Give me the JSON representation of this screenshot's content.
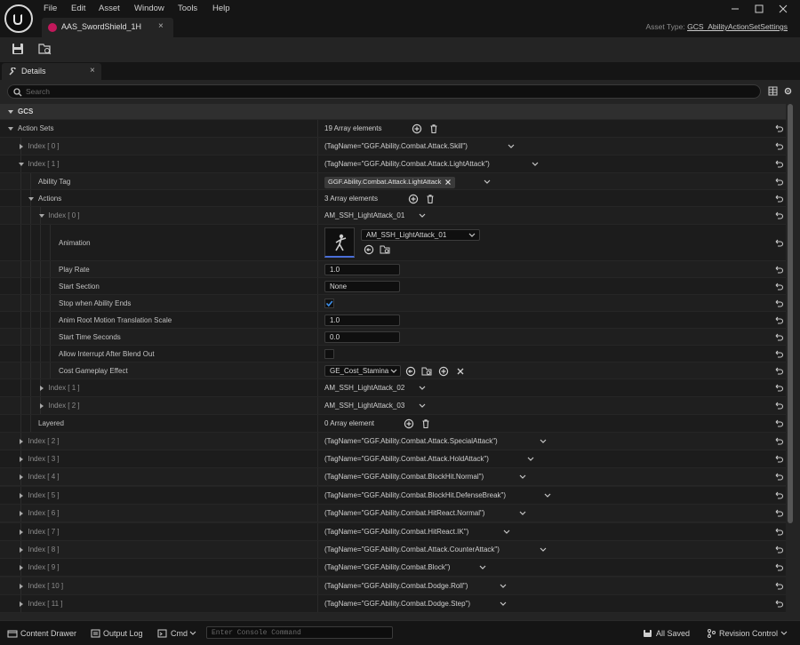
{
  "window": {
    "menu": [
      "File",
      "Edit",
      "Asset",
      "Window",
      "Tools",
      "Help"
    ],
    "tab_title": "AAS_SwordShield_1H",
    "asset_type_label": "Asset Type:",
    "asset_type_value": "GCS_AbilityActionSetSettings"
  },
  "details": {
    "tab_label": "Details",
    "search_placeholder": "Search"
  },
  "category": "GCS",
  "rows": [
    {
      "name": "Action Sets",
      "value": "19 Array elements"
    },
    {
      "name": "Index [ 0 ]",
      "value": "(TagName=\"GGF.Ability.Combat.Attack.Skill\")"
    },
    {
      "name": "Index [ 1 ]",
      "value": "(TagName=\"GGF.Ability.Combat.Attack.LightAttack\")"
    },
    {
      "name": "Ability Tag",
      "value": "GGF.Ability.Combat.Attack.LightAttack"
    },
    {
      "name": "Actions",
      "value": "3 Array elements"
    },
    {
      "name": "Index [ 0 ]",
      "value": "AM_SSH_LightAttack_01"
    },
    {
      "name": "Animation",
      "value": "AM_SSH_LightAttack_01"
    },
    {
      "name": "Play Rate",
      "value": "1.0"
    },
    {
      "name": "Start Section",
      "value": "None"
    },
    {
      "name": "Stop when Ability Ends",
      "value": true
    },
    {
      "name": "Anim Root Motion Translation Scale",
      "value": "1.0"
    },
    {
      "name": "Start Time Seconds",
      "value": "0.0"
    },
    {
      "name": "Allow Interrupt After Blend Out",
      "value": false
    },
    {
      "name": "Cost Gameplay Effect",
      "value": "GE_Cost_Stamina"
    },
    {
      "name": "Index [ 1 ]",
      "value": "AM_SSH_LightAttack_02"
    },
    {
      "name": "Index [ 2 ]",
      "value": "AM_SSH_LightAttack_03"
    },
    {
      "name": "Layered",
      "value": "0 Array element"
    },
    {
      "name": "Index [ 2 ]",
      "value": "(TagName=\"GGF.Ability.Combat.Attack.SpecialAttack\")"
    },
    {
      "name": "Index [ 3 ]",
      "value": "(TagName=\"GGF.Ability.Combat.Attack.HoldAttack\")"
    },
    {
      "name": "Index [ 4 ]",
      "value": "(TagName=\"GGF.Ability.Combat.BlockHit.Normal\")"
    },
    {
      "name": "Index [ 5 ]",
      "value": "(TagName=\"GGF.Ability.Combat.BlockHit.DefenseBreak\")"
    },
    {
      "name": "Index [ 6 ]",
      "value": "(TagName=\"GGF.Ability.Combat.HitReact.Normal\")"
    },
    {
      "name": "Index [ 7 ]",
      "value": "(TagName=\"GGF.Ability.Combat.HitReact.IK\")"
    },
    {
      "name": "Index [ 8 ]",
      "value": "(TagName=\"GGF.Ability.Combat.Attack.CounterAttack\")"
    },
    {
      "name": "Index [ 9 ]",
      "value": "(TagName=\"GGF.Ability.Combat.Block\")"
    },
    {
      "name": "Index [ 10 ]",
      "value": "(TagName=\"GGF.Ability.Combat.Dodge.Roll\")"
    },
    {
      "name": "Index [ 11 ]",
      "value": "(TagName=\"GGF.Ability.Combat.Dodge.Step\")"
    }
  ],
  "statusbar": {
    "content_drawer": "Content Drawer",
    "output_log": "Output Log",
    "cmd": "Cmd",
    "console_placeholder": "Enter Console Command",
    "all_saved": "All Saved",
    "revision_control": "Revision Control"
  },
  "colors": {
    "background": "#151515",
    "panel": "#242424",
    "row": "#1c1c1c",
    "accent_check": "#3d8ee8",
    "asset_icon": "#c2185b"
  }
}
